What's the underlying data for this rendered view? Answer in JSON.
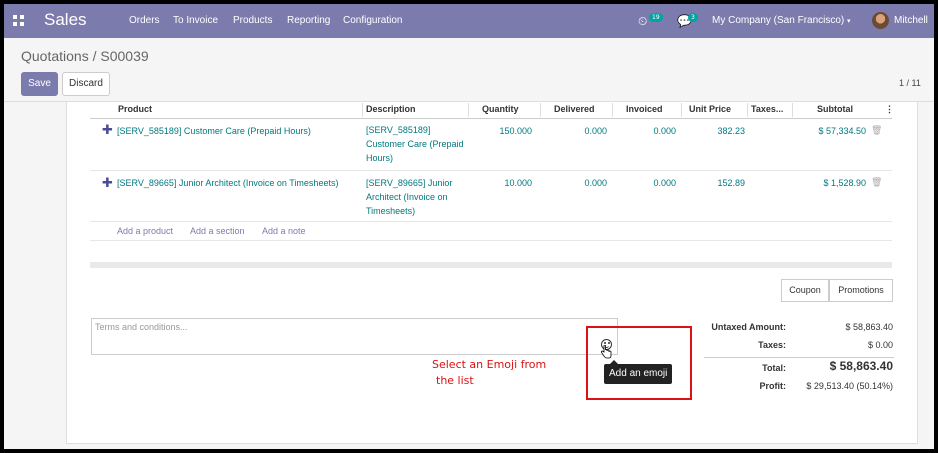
{
  "navbar": {
    "app_name": "Sales",
    "menu": [
      "Orders",
      "To Invoice",
      "Products",
      "Reporting",
      "Configuration"
    ],
    "activity_count": "19",
    "messages_count": "3",
    "company": "My Company (San Francisco)",
    "user": "Mitchell",
    "colors": {
      "bar": "#7c7bad",
      "badge": "#01a3a3"
    }
  },
  "control_panel": {
    "breadcrumb": "Quotations / S00039",
    "save": "Save",
    "discard": "Discard",
    "pager": "1 / 11"
  },
  "lines_table": {
    "headers": [
      "Product",
      "Description",
      "Quantity",
      "Delivered",
      "Invoiced",
      "Unit Price",
      "Taxes...",
      "Subtotal"
    ],
    "rows": [
      {
        "product": "[SERV_585189] Customer Care (Prepaid Hours)",
        "description": "[SERV_585189] Customer Care (Prepaid Hours)",
        "quantity": "150.000",
        "delivered": "0.000",
        "invoiced": "0.000",
        "unit_price": "382.23",
        "taxes": "",
        "subtotal": "$ 57,334.50"
      },
      {
        "product": "[SERV_89665] Junior Architect (Invoice on Timesheets)",
        "description": "[SERV_89665] Junior Architect (Invoice on Timesheets)",
        "quantity": "10.000",
        "delivered": "0.000",
        "invoiced": "0.000",
        "unit_price": "152.89",
        "taxes": "",
        "subtotal": "$ 1,528.90"
      }
    ],
    "add_product": "Add a product",
    "add_section": "Add a section",
    "add_note": "Add a note"
  },
  "buttons": {
    "coupon": "Coupon",
    "promotions": "Promotions"
  },
  "terms": {
    "placeholder": "Terms and conditions..."
  },
  "totals": {
    "untaxed_label": "Untaxed Amount:",
    "untaxed_value": "$ 58,863.40",
    "taxes_label": "Taxes:",
    "taxes_value": "$ 0.00",
    "total_label": "Total:",
    "total_value": "$ 58,863.40",
    "profit_label": "Profit:",
    "profit_value": "$ 29,513.40 (50.14%)"
  },
  "annotation": {
    "line1": "Select an Emoji from",
    "line2": "the list",
    "tooltip": "Add an emoji",
    "color": "#dd1111"
  }
}
